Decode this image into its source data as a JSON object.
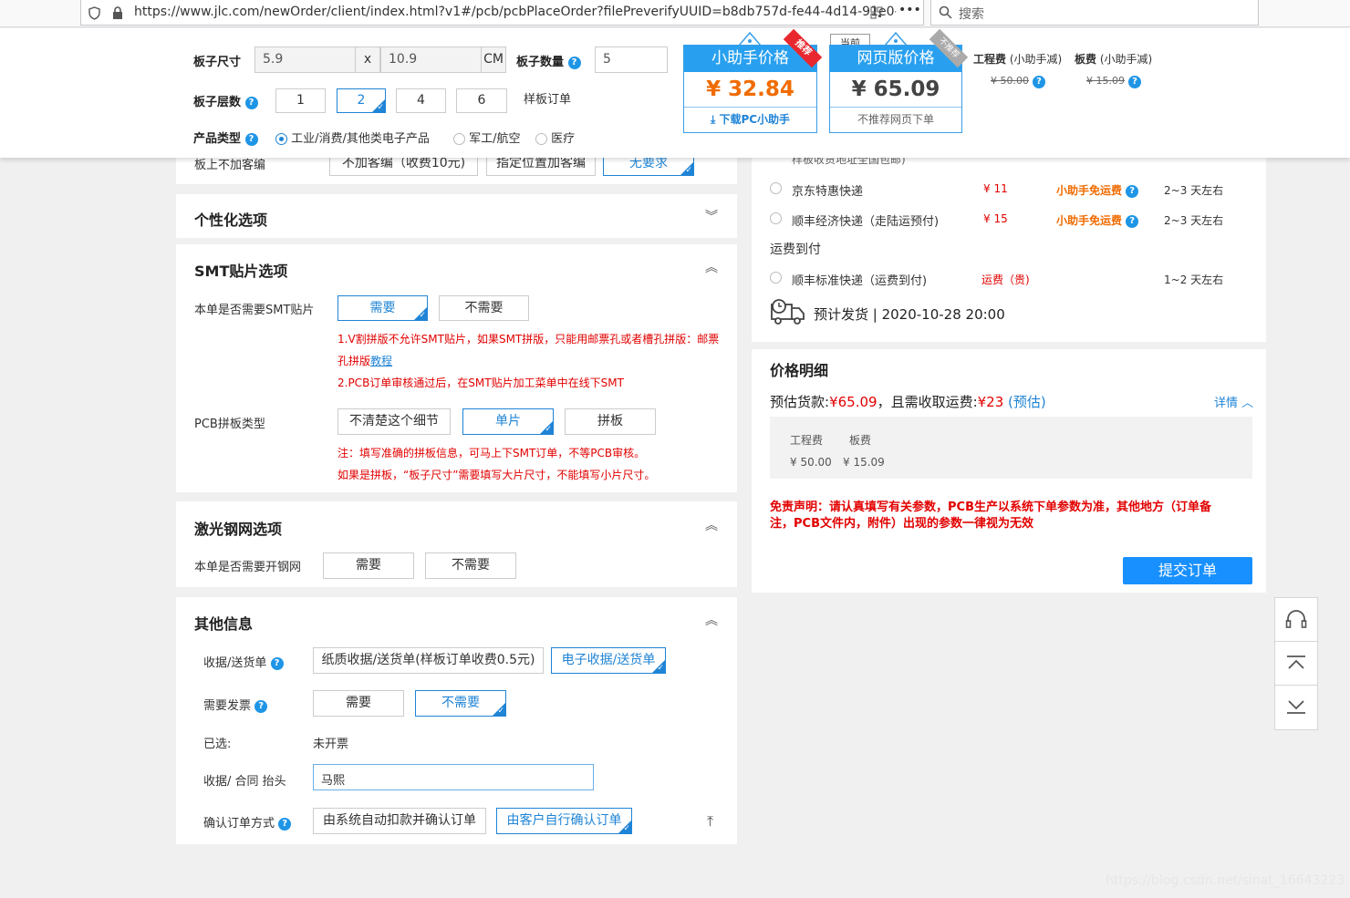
{
  "browser": {
    "url": "https://www.jlc.com/newOrder/client/index.html?v1#/pcb/pcbPlaceOrder?filePreverifyUUID=b8db757d-fe44-4d14-91e0-",
    "search_placeholder": "搜索",
    "menu": "•••"
  },
  "top": {
    "size_label": "板子尺寸",
    "size_w": "5.9",
    "size_x": "x",
    "size_h": "10.9",
    "size_unit": "CM",
    "qty_label": "板子数量",
    "qty_value": "5",
    "layers_label": "板子层数",
    "layers": [
      "1",
      "2",
      "4",
      "6"
    ],
    "sample_order": "样板订单",
    "product_label": "产品类型",
    "products": [
      "工业/消费/其他类电子产品",
      "军工/航空",
      "医疗"
    ]
  },
  "cards": {
    "helper": {
      "title": "小助手价格",
      "badge": "推荐",
      "price": "¥ 32.84",
      "footer": "下载PC小助手"
    },
    "web": {
      "title": "网页版价格",
      "tag": "当前",
      "badge": "不推荐",
      "price": "¥ 65.09",
      "footer": "不推荐网页下单"
    }
  },
  "fees": {
    "eng_label": "工程费",
    "eng_note": "(小助手减)",
    "eng_value": "¥ 50.00",
    "board_label": "板费",
    "board_note": "(小助手减)",
    "board_value": "¥ 15.09"
  },
  "left": {
    "partial_label": "板上不加客编",
    "partial_opts": [
      "不加客编（收费10元)",
      "指定位置加客编",
      "无要求"
    ],
    "personal_title": "个性化选项",
    "smt_title": "SMT贴片选项",
    "smt_need_label": "本单是否需要SMT贴片",
    "smt_opts": [
      "需要",
      "不需要"
    ],
    "smt_note1": "1.V割拼版不允许SMT贴片，如果SMT拼版，只能用邮票孔或者槽孔拼版：邮票",
    "smt_note1b": "孔拼版",
    "smt_note1_link": "教程",
    "smt_note2": "2.PCB订单审核通过后，在SMT贴片加工菜单中在线下SMT",
    "pcb_panel_label": "PCB拼板类型",
    "pcb_panel_opts": [
      "不清楚这个细节",
      "单片",
      "拼板"
    ],
    "pcb_note1": "注：填写准确的拼板信息，可马上下SMT订单，不等PCB审核。",
    "pcb_note2": "如果是拼板，“板子尺寸”需要填写大片尺寸，不能填写小片尺寸。",
    "stencil_title": "激光钢网选项",
    "stencil_label": "本单是否需要开钢网",
    "stencil_opts": [
      "需要",
      "不需要"
    ],
    "other_title": "其他信息",
    "receipt_label": "收据/送货单",
    "receipt_opts": [
      "纸质收据/送货单(样板订单收费0.5元)",
      "电子收据/送货单"
    ],
    "invoice_label": "需要发票",
    "invoice_opts": [
      "需要",
      "不需要"
    ],
    "selected_label": "已选:",
    "selected_value": "未开票",
    "header_label": "收据/ 合同 抬头",
    "header_value": "马熙",
    "confirm_label": "确认订单方式",
    "confirm_opts": [
      "由系统自动扣款并确认订单",
      "由客户自行确认订单"
    ]
  },
  "shipping": {
    "partial_text": "样板收货地址全国包邮)",
    "rows": [
      {
        "name": "京东特惠快递",
        "price": "¥ 11",
        "note": "小助手免运费",
        "time": "2~3 天左右"
      },
      {
        "name": "顺丰经济快递（走陆运预付)",
        "price": "¥ 15",
        "note": "小助手免运费",
        "time": "2~3 天左右"
      }
    ],
    "cod_title": "运费到付",
    "cod_row": {
      "name": "顺丰标准快递（运费到付)",
      "price": "运费（贵)",
      "time": "1~2 天左右"
    },
    "eta": "预计发货 | 2020-10-28 20:00"
  },
  "price_detail": {
    "title": "价格明细",
    "est_label": "预估货款:",
    "est_value": "¥65.09",
    "freight_label": "，且需收取运费:",
    "freight_value": "¥23",
    "freight_note": "(预估)",
    "detail_link": "详情",
    "col1": "工程费",
    "col2": "板费",
    "val1": "¥ 50.00",
    "val2": "¥ 15.09",
    "disclaimer1": "免责声明：请认真填写有关参数，PCB生产以系统下单参数为准，其他地方（订单备",
    "disclaimer2": "注，PCB文件内，附件）出现的参数一律视为无效",
    "submit": "提交订单"
  },
  "watermark": "https://blog.csdn.net/sinat_16643223",
  "colors": {
    "accent": "#1f84d6",
    "red": "#e20000",
    "orange": "#f06b00",
    "submit": "#1890ff"
  }
}
